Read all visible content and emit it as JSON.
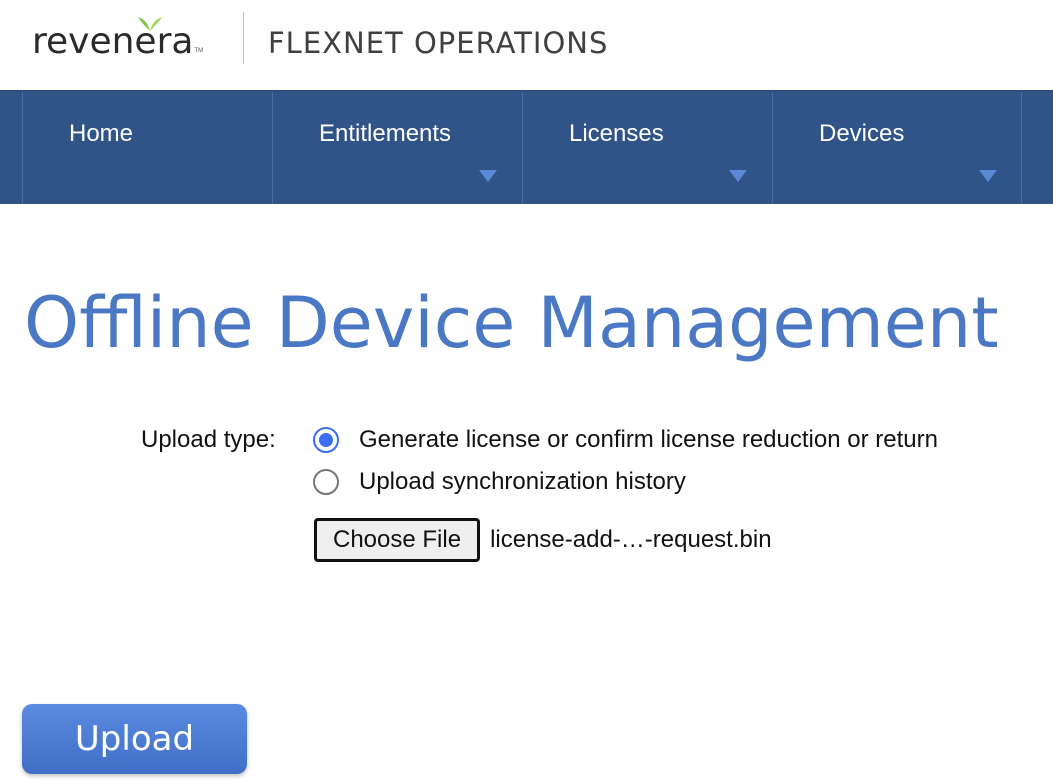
{
  "header": {
    "logo_text": "revenera",
    "logo_tm": "TM",
    "product_name": "FLEXNET OPERATIONS"
  },
  "nav": {
    "items": [
      {
        "label": "Home",
        "has_dropdown": false
      },
      {
        "label": "Entitlements",
        "has_dropdown": true
      },
      {
        "label": "Licenses",
        "has_dropdown": true
      },
      {
        "label": "Devices",
        "has_dropdown": true
      }
    ]
  },
  "page": {
    "title": "Offline Device Management"
  },
  "form": {
    "upload_type_label": "Upload type:",
    "options": [
      {
        "label": "Generate license or confirm license reduction or return",
        "checked": true
      },
      {
        "label": "Upload synchronization history",
        "checked": false
      }
    ],
    "choose_file_label": "Choose File",
    "selected_file": "license-add-…-request.bin",
    "upload_button_label": "Upload"
  },
  "colors": {
    "nav_background": "#305388",
    "title_color": "#4a78c4",
    "radio_accent": "#3b6ef0",
    "upload_button": "#4a7bd6",
    "logo_leaf": "#7dc242"
  },
  "icons": {
    "dropdown": "caret-down-icon",
    "logo_mark": "leaf-icon"
  }
}
